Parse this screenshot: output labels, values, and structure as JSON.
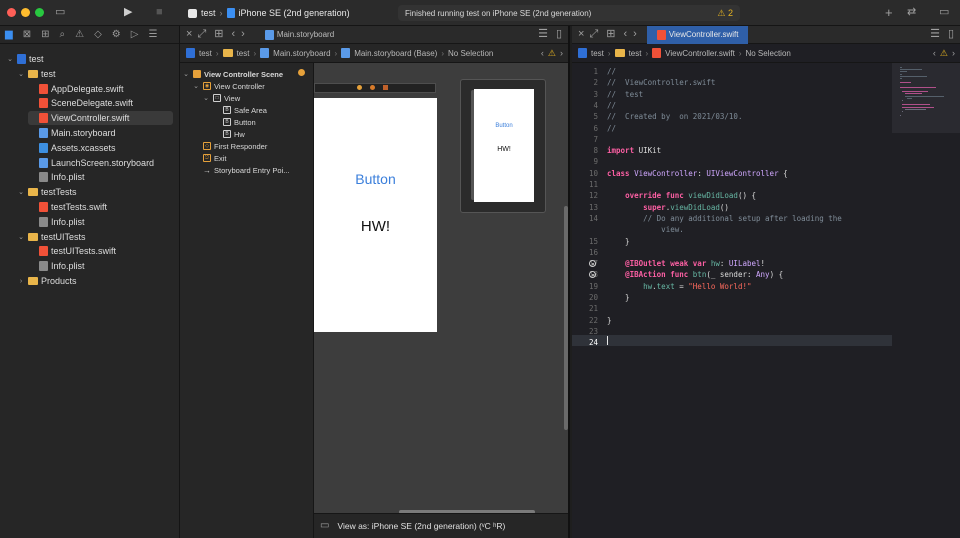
{
  "toolbar": {
    "project": "test",
    "destination": "iPhone SE (2nd generation)",
    "status": "Finished running test on iPhone SE (2nd generation)",
    "warning_count": "2"
  },
  "navigator": {
    "items": [
      {
        "label": "test",
        "kind": "proj",
        "indent": 0,
        "chevron": "v"
      },
      {
        "label": "test",
        "kind": "folder",
        "indent": 1,
        "chevron": "v"
      },
      {
        "label": "AppDelegate.swift",
        "kind": "swift",
        "indent": 2,
        "chevron": ""
      },
      {
        "label": "SceneDelegate.swift",
        "kind": "swift",
        "indent": 2,
        "chevron": ""
      },
      {
        "label": "ViewController.swift",
        "kind": "swift",
        "indent": 2,
        "chevron": "",
        "selected": true
      },
      {
        "label": "Main.storyboard",
        "kind": "sb",
        "indent": 2,
        "chevron": ""
      },
      {
        "label": "Assets.xcassets",
        "kind": "assets",
        "indent": 2,
        "chevron": ""
      },
      {
        "label": "LaunchScreen.storyboard",
        "kind": "sb",
        "indent": 2,
        "chevron": ""
      },
      {
        "label": "Info.plist",
        "kind": "plist",
        "indent": 2,
        "chevron": ""
      },
      {
        "label": "testTests",
        "kind": "folder",
        "indent": 1,
        "chevron": "v"
      },
      {
        "label": "testTests.swift",
        "kind": "swift",
        "indent": 2,
        "chevron": ""
      },
      {
        "label": "Info.plist",
        "kind": "plist",
        "indent": 2,
        "chevron": ""
      },
      {
        "label": "testUITests",
        "kind": "folder",
        "indent": 1,
        "chevron": "v"
      },
      {
        "label": "testUITests.swift",
        "kind": "swift",
        "indent": 2,
        "chevron": ""
      },
      {
        "label": "Info.plist",
        "kind": "plist",
        "indent": 2,
        "chevron": ""
      },
      {
        "label": "Products",
        "kind": "folder",
        "indent": 1,
        "chevron": ">"
      }
    ]
  },
  "editor1": {
    "tab": "Main.storyboard",
    "jump": [
      "test",
      "test",
      "Main.storyboard",
      "Main.storyboard (Base)",
      "No Selection"
    ],
    "outline": [
      {
        "label": "View Controller Scene",
        "indent": 0,
        "chevron": "v",
        "icon": "",
        "bold": true
      },
      {
        "label": "View Controller",
        "indent": 1,
        "chevron": "v",
        "icon": "vc"
      },
      {
        "label": "View",
        "indent": 2,
        "chevron": "v",
        "icon": "view"
      },
      {
        "label": "Safe Area",
        "indent": 3,
        "chevron": "",
        "icon": "box"
      },
      {
        "label": "Button",
        "indent": 3,
        "chevron": "",
        "icon": "box"
      },
      {
        "label": "Hw",
        "indent": 3,
        "chevron": "",
        "icon": "box"
      },
      {
        "label": "First Responder",
        "indent": 1,
        "chevron": "",
        "icon": "fr"
      },
      {
        "label": "Exit",
        "indent": 1,
        "chevron": "",
        "icon": "exit"
      },
      {
        "label": "Storyboard Entry Poi...",
        "indent": 1,
        "chevron": "",
        "icon": "arrow"
      }
    ],
    "scene_button": "Button",
    "scene_label": "HW!",
    "mini_button": "Button",
    "mini_label": "HW!",
    "view_as": "View as: iPhone SE (2nd generation) (ᵛC ʰR)"
  },
  "editor2": {
    "tab": "ViewController.swift",
    "jump": [
      "test",
      "test",
      "ViewController.swift",
      "No Selection"
    ],
    "current_line": 24,
    "code": [
      {
        "n": 1,
        "html": "<span class='cm'>//</span>"
      },
      {
        "n": 2,
        "html": "<span class='cm'>//  ViewController.swift</span>"
      },
      {
        "n": 3,
        "html": "<span class='cm'>//  test</span>"
      },
      {
        "n": 4,
        "html": "<span class='cm'>//</span>"
      },
      {
        "n": 5,
        "html": "<span class='cm'>//  Created by  on 2021/03/10.</span>"
      },
      {
        "n": 6,
        "html": "<span class='cm'>//</span>"
      },
      {
        "n": 7,
        "html": ""
      },
      {
        "n": 8,
        "html": "<span class='kw'>import</span> UIKit"
      },
      {
        "n": 9,
        "html": ""
      },
      {
        "n": 10,
        "html": "<span class='kw'>class</span> <span class='ty'>ViewController</span>: <span class='ty'>UIViewController</span> {"
      },
      {
        "n": 11,
        "html": ""
      },
      {
        "n": 12,
        "html": "    <span class='kw'>override func</span> <span class='fn'>viewDidLoad</span>() {"
      },
      {
        "n": 13,
        "html": "        <span class='kw'>super</span>.<span class='fn'>viewDidLoad</span>()"
      },
      {
        "n": 14,
        "html": "        <span class='cm'>// Do any additional setup after loading the</span>"
      },
      {
        "n": null,
        "html": "<span class='cm'>            view.</span>"
      },
      {
        "n": 15,
        "html": "    }"
      },
      {
        "n": 16,
        "html": ""
      },
      {
        "n": 17,
        "html": "    <span class='kw'>@IBOutlet weak var</span> <span class='fn'>hw</span>: <span class='ty'>UILabel</span>!",
        "conn": true
      },
      {
        "n": 18,
        "html": "    <span class='kw'>@IBAction func</span> <span class='fn'>btn</span>(_ sender: <span class='ty'>Any</span>) {",
        "conn": true
      },
      {
        "n": 19,
        "html": "        <span class='fn'>hw</span>.<span class='fn'>text</span> = <span class='st'>\"Hello World!\"</span>"
      },
      {
        "n": 20,
        "html": "    }"
      },
      {
        "n": 21,
        "html": ""
      },
      {
        "n": 22,
        "html": "}"
      },
      {
        "n": 23,
        "html": ""
      },
      {
        "n": 24,
        "html": ""
      }
    ]
  },
  "colors": {
    "accent": "#3b8ff2",
    "keyword": "#fc5fa3",
    "comment": "#7f8c98",
    "string": "#fc6a5d",
    "type": "#d0a8ff",
    "warning": "#e6b422"
  }
}
